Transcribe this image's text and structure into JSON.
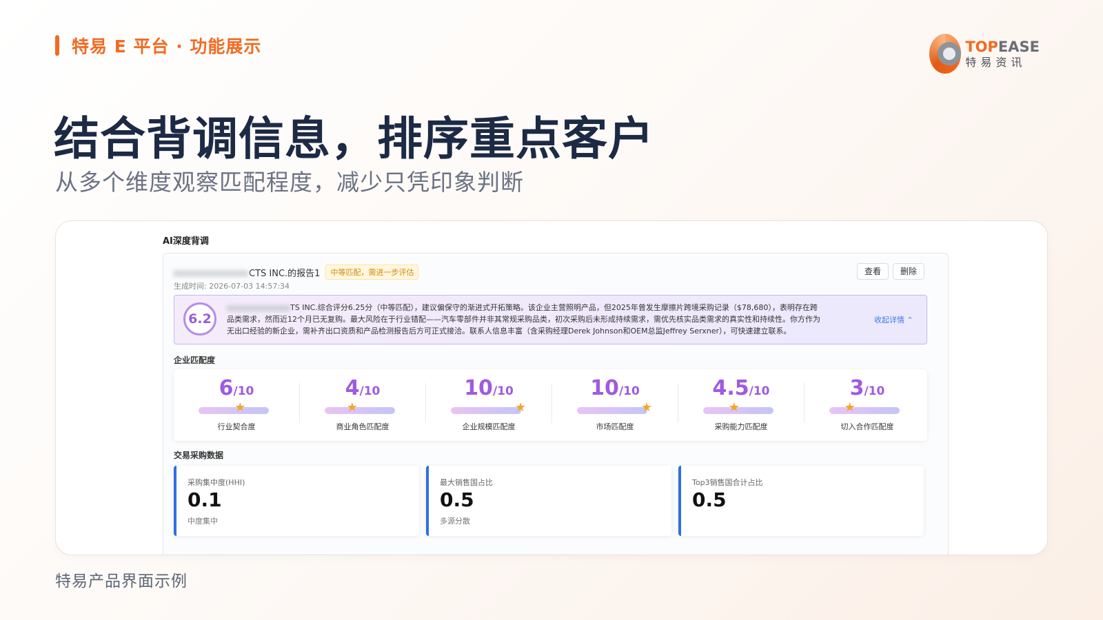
{
  "header": {
    "section_tag": "特易 E 平台 · 功能展示",
    "logo_en_a": "TOP",
    "logo_en_b": "EASE",
    "logo_cn": "特易资讯"
  },
  "title": "结合背调信息，排序重点客户",
  "subtitle": "从多个维度观察匹配程度，减少只凭印象判断",
  "app": {
    "title": "AI深度背调",
    "report": {
      "name_suffix": "CTS INC.的报告1",
      "badge": "中等匹配，需进一步评估",
      "generated_time": "生成时间: 2026-07-03 14:57:34",
      "view_label": "查看",
      "delete_label": "删除"
    },
    "summary": {
      "score": "6.2",
      "text_1": "TS INC.综合评分6.25分（中等匹配），建议偏保守的渐进式开拓策略。该企业主营照明产品，但2025年曾发生摩擦片跨境采购记录（$78,680），表明存在跨",
      "text_2": "品类需求，然而近12个月已无复购。最大风险在于行业错配——汽车零部件并非其常规采购品类，初次采购后未形成持续需求，需优先核实品类需求的真实性和持续性。你方作为",
      "text_3": "无出口经验的新企业，需补齐出口资质和产品检测报告后方可正式接洽。联系人信息丰富（含采购经理Derek Johnson和OEM总监Jeffrey Serxner），可快速建立联系。",
      "collapse_label": "收起详情"
    },
    "match": {
      "label": "企业匹配度",
      "denominator": "/10",
      "items": [
        {
          "value": "6",
          "score": 0.6,
          "label": "行业契合度"
        },
        {
          "value": "4",
          "score": 0.4,
          "label": "商业角色匹配度"
        },
        {
          "value": "10",
          "score": 1.0,
          "label": "企业规模匹配度"
        },
        {
          "value": "10",
          "score": 1.0,
          "label": "市场匹配度"
        },
        {
          "value": "4.5",
          "score": 0.45,
          "label": "采购能力匹配度"
        },
        {
          "value": "3",
          "score": 0.3,
          "label": "切入合作匹配度"
        }
      ]
    },
    "trade": {
      "label": "交易采购数据",
      "cards": [
        {
          "title": "采购集中度(HHI)",
          "value": "0.1",
          "sub": "中度集中"
        },
        {
          "title": "最大销售国占比",
          "value": "0.5",
          "sub": "多源分散"
        },
        {
          "title": "Top3销售国合计占比",
          "value": "0.5",
          "sub": ""
        }
      ]
    }
  },
  "caption": "特易产品界面示例",
  "colors": {
    "accent": "#f26a21",
    "score_purple": "#a05ae0",
    "card_blue": "#2f6fe4",
    "star": "#f5a623"
  }
}
